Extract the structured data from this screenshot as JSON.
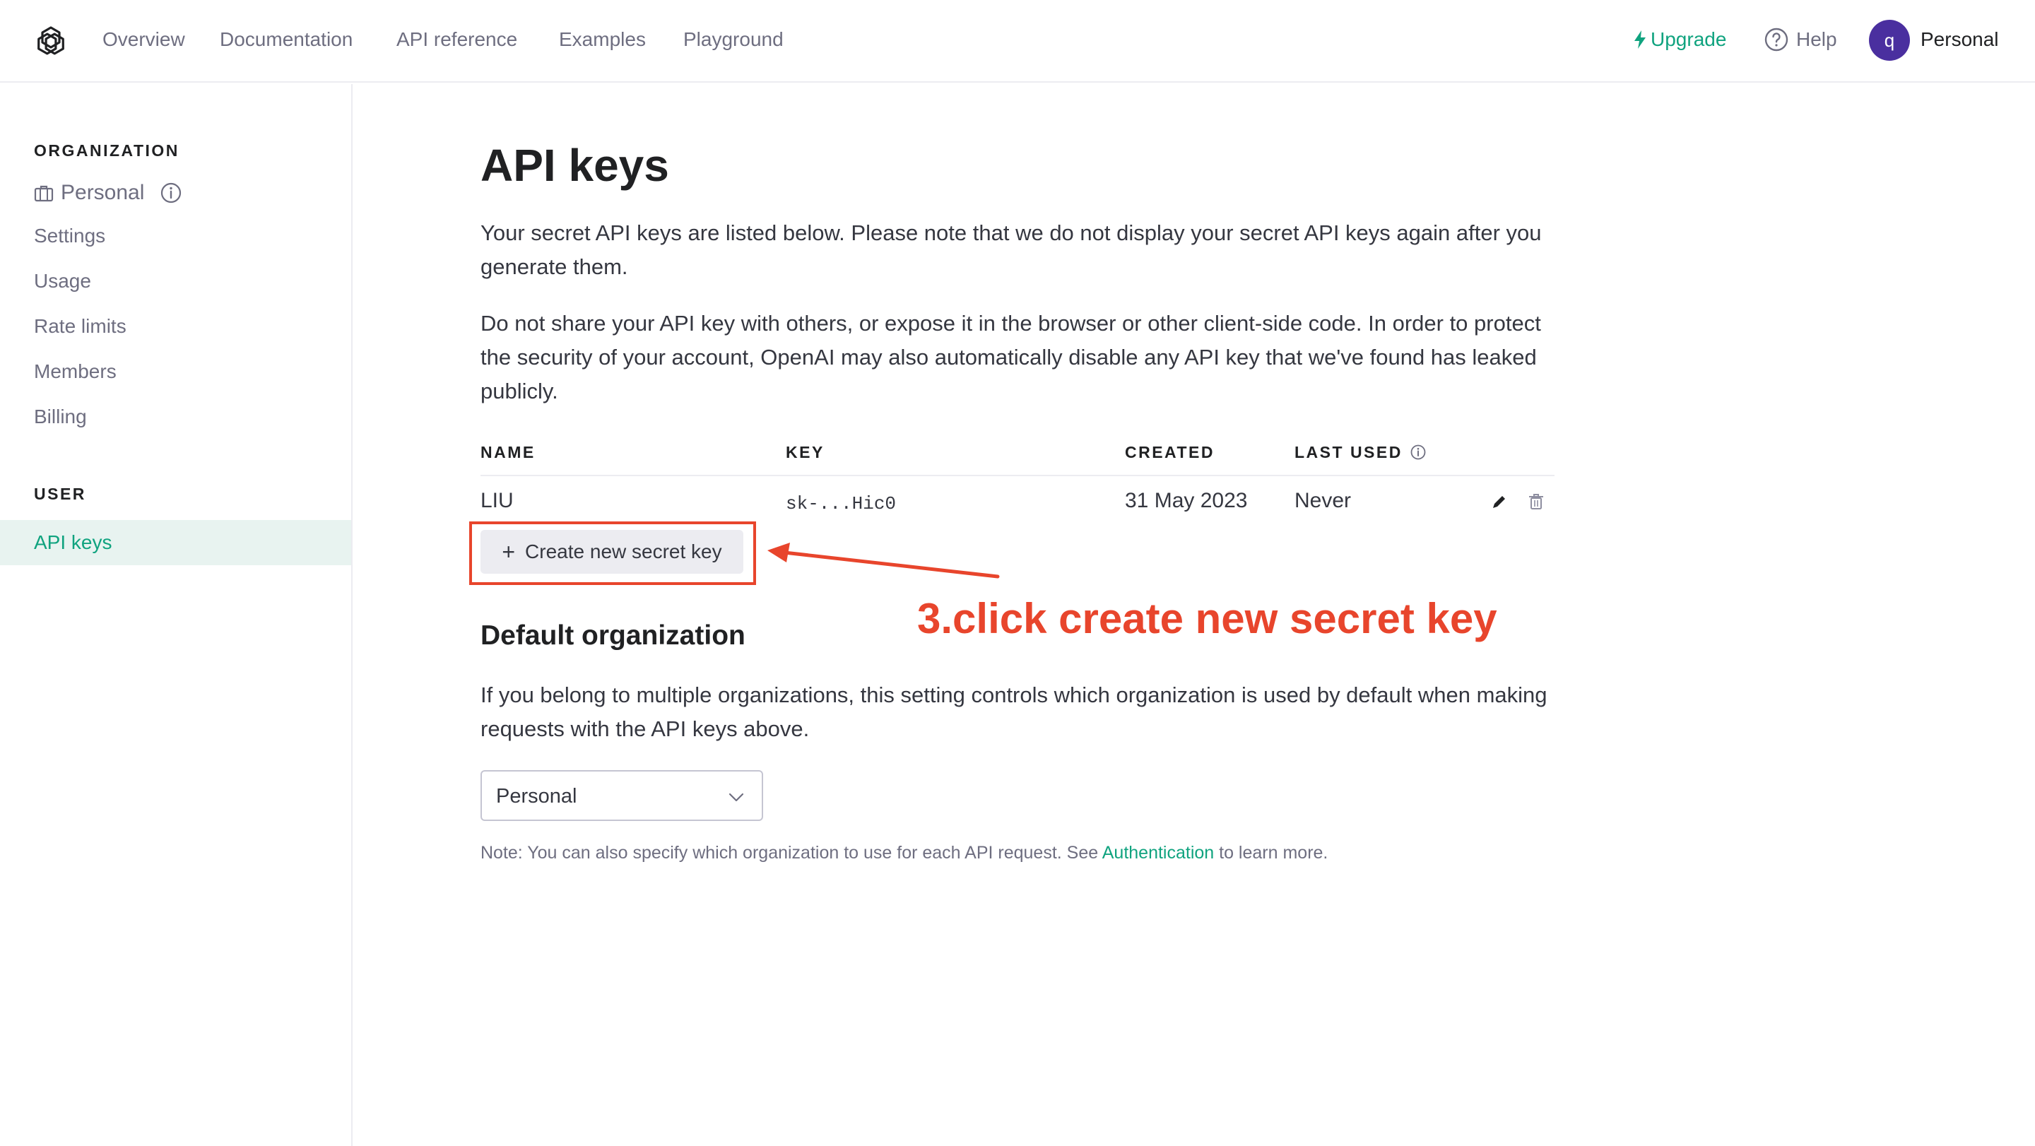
{
  "nav": {
    "links": [
      "Overview",
      "Documentation",
      "API reference",
      "Examples",
      "Playground"
    ],
    "upgrade": "Upgrade",
    "help": "Help",
    "avatar_initial": "q",
    "user": "Personal"
  },
  "sidebar": {
    "org_heading": "ORGANIZATION",
    "org_name": "Personal",
    "org_items": [
      "Settings",
      "Usage",
      "Rate limits",
      "Members",
      "Billing"
    ],
    "user_heading": "USER",
    "active_item": "API keys"
  },
  "main": {
    "title": "API keys",
    "para1": "Your secret API keys are listed below. Please note that we do not display your secret API keys again after you generate them.",
    "para2": "Do not share your API key with others, or expose it in the browser or other client-side code. In order to protect the security of your account, OpenAI may also automatically disable any API key that we've found has leaked publicly.",
    "table": {
      "headers": [
        "NAME",
        "KEY",
        "CREATED",
        "LAST USED"
      ],
      "rows": [
        {
          "name": "LIU",
          "key": "sk-...Hic0",
          "created": "31 May 2023",
          "last_used": "Never"
        }
      ]
    },
    "create_button": "Create new secret key",
    "default_org_title": "Default organization",
    "default_org_desc": "If you belong to multiple organizations, this setting controls which organization is used by default when making requests with the API keys above.",
    "select_value": "Personal",
    "note_prefix": "Note: You can also specify which organization to use for each API request. See ",
    "note_link": "Authentication",
    "note_suffix": " to learn more."
  },
  "annotation": {
    "text": "3.click create new secret key",
    "color": "#e8452c"
  },
  "colors": {
    "accent": "#10a37f",
    "avatar": "#4a2f9f"
  }
}
